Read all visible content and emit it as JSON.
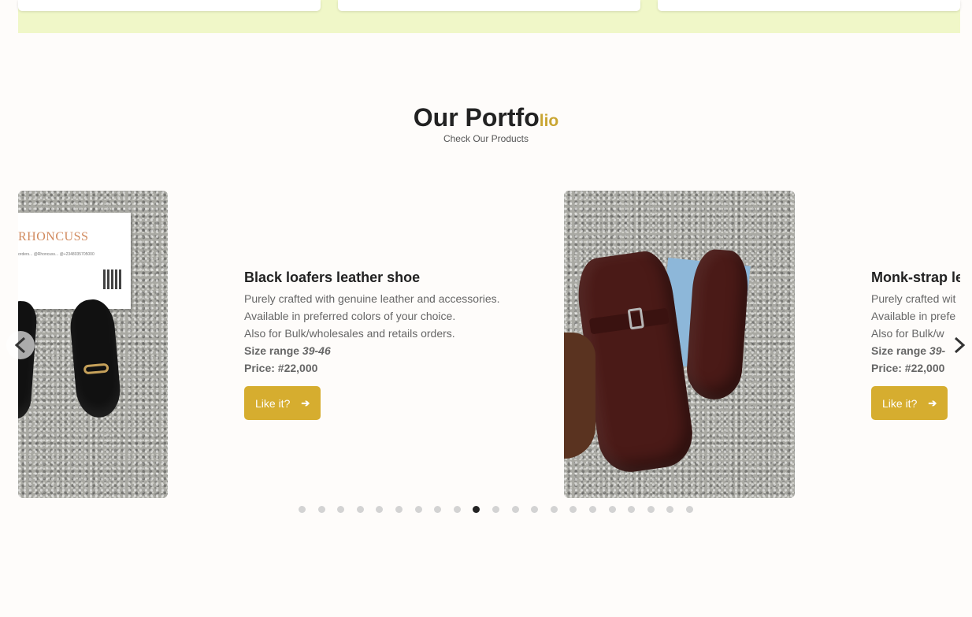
{
  "section": {
    "title_main": "Our Portfo",
    "title_accent": "lio",
    "subtitle": "Check Our Products"
  },
  "left_photo": {
    "brand_text": "RHONCUSS",
    "brand_line": "orders...  @Rhoncuss...  @+2348035705000"
  },
  "products": [
    {
      "title": "Black loafers leather shoe",
      "line1": "Purely crafted with genuine leather and accessories.",
      "line2": "Available in preferred colors of your choice.",
      "line3": "Also for Bulk/wholesales and retails orders.",
      "size_label": "Size range",
      "size_value": "39-46",
      "price": "Price: #22,000",
      "button": "Like it?",
      "button_arrow": "➔"
    },
    {
      "title": "Monk-strap le",
      "line1": "Purely crafted wit",
      "line2": "Available in prefe",
      "line3": "Also for Bulk/w",
      "size_label": "Size range",
      "size_value": "39-",
      "price": "Price: #22,000",
      "button": "Like it?",
      "button_arrow": "➔"
    }
  ],
  "carousel": {
    "prev_icon": "chevron-left-icon",
    "next_icon": "chevron-right-icon",
    "dot_count": 21,
    "active_dot_index": 9
  },
  "colors": {
    "accent": "#d6ad2f",
    "band": "#f0f7c8",
    "background": "#fefcfa"
  }
}
